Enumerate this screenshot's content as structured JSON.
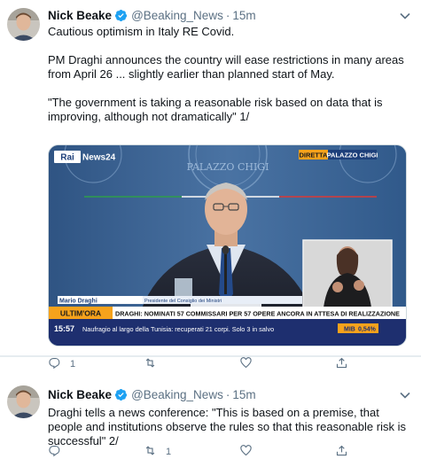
{
  "tweets": [
    {
      "author": {
        "name": "Nick Beake",
        "handle": "@Beaking_News",
        "time": "15m"
      },
      "text": [
        "Cautious optimism in Italy RE Covid.",
        "PM Draghi announces the country will ease restrictions in many areas from April 26 ... slightly earlier than planned start of May.",
        "\"The government is taking a reasonable risk based on data that is improving, although not dramatically\"  1/"
      ],
      "media": {
        "channel_logo": "Rai",
        "channel_suffix": "News24",
        "live_label": "DIRETTA",
        "location_label": "PALAZZO CHIGI",
        "seal_text": "PALAZZO CHIGI",
        "speaker_name": "Mario Draghi",
        "speaker_role": "Presidente del Consiglio dei Ministri",
        "ticker_tag": "ULTIM'ORA",
        "ticker_headline": "DRAGHI: NOMINATI 57 COMMISSARI PER 57 OPERE ANCORA IN ATTESA DI REALIZZAZIONE",
        "clock": "15:57",
        "ticker_news": "Naufragio al largo della Tunisia: recuperati 21 corpi. Solo 3 in salvo",
        "market_label": "MIB",
        "market_value": "0,54%"
      },
      "actions": {
        "reply": "1",
        "retweet": "",
        "like": "",
        "share": ""
      }
    },
    {
      "author": {
        "name": "Nick Beake",
        "handle": "@Beaking_News",
        "time": "15m"
      },
      "text": [
        "Draghi tells a news conference: \"This is based on a premise, that people and institutions observe the rules so that this reasonable risk is successful\" 2/"
      ],
      "actions": {
        "reply": "",
        "retweet": "1",
        "like": "",
        "share": ""
      }
    }
  ],
  "icons": [
    "verified-badge-icon",
    "chevron-down-icon",
    "reply-icon",
    "retweet-icon",
    "like-icon",
    "share-icon"
  ],
  "colors": {
    "verified": "#1da1f2",
    "secondary_text": "#5b7083",
    "rai_blue": "#1d3f7a",
    "ticker_orange": "#f6a21c",
    "ticker_blue": "#2c3f8f"
  }
}
